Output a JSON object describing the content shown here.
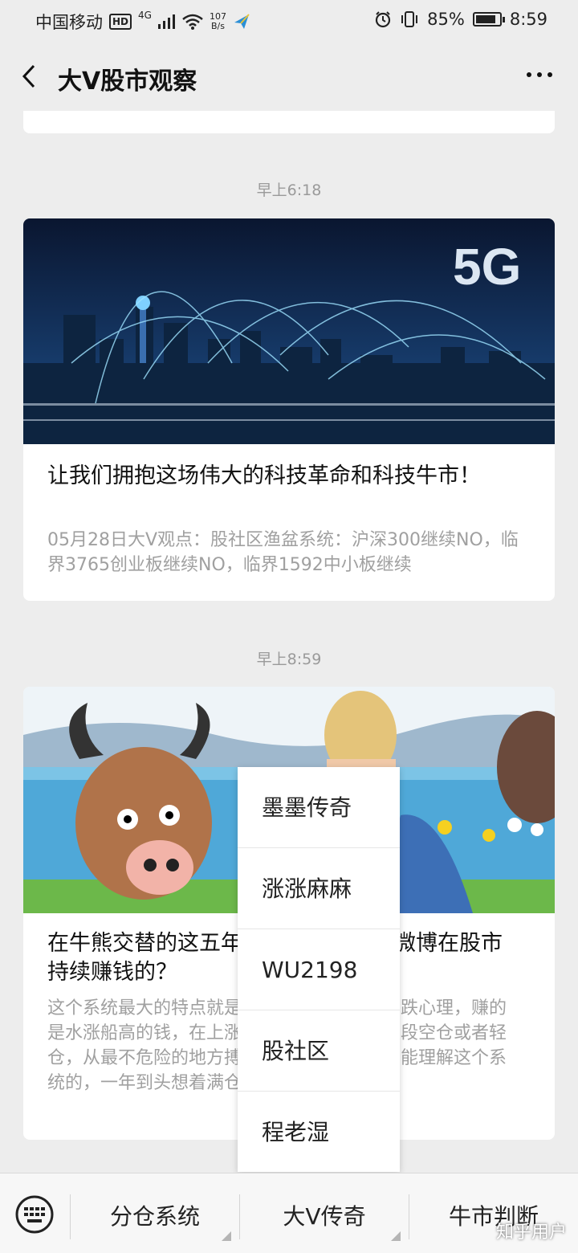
{
  "status_bar": {
    "carrier": "中国移动",
    "hd": "HD",
    "signal": "4G",
    "net_speed_value": "107",
    "net_speed_unit": "B/s",
    "battery": "85%",
    "battery_level": 0.85,
    "time": "8:59"
  },
  "header": {
    "title": "大V股市观察"
  },
  "messages": [
    {
      "time": "早上6:18",
      "image_text": "5G",
      "title": "让我们拥抱这场伟大的科技革命和科技牛市！",
      "desc": "05月28日大V观点：股社区渔盆系统：沪深300继续NO，临界3765创业板继续NO，临界1592中小板继续"
    },
    {
      "time": "早上8:59",
      "title": "在牛熊交替的这五年，他是如何靠刷微博在股市持续赚钱的？",
      "desc": "这个系统最大的特点就是利用散户们的追涨杀跌心理，赚的是水涨船高的钱，在上涨波段重仓，在下跌波段空仓或者轻仓，从最不危险的地方搏杀回来的钱散户是不能理解这个系统的，一年到头想着满仓赚不"
    }
  ],
  "popup_menu": {
    "items": [
      "墨墨传奇",
      "涨涨麻麻",
      "WU2198",
      "股社区",
      "程老湿"
    ]
  },
  "bottom_menu": {
    "items": [
      "分仓系统",
      "大V传奇",
      "牛市判断"
    ]
  },
  "watermark": "知乎用户",
  "colors": {
    "background": "#ededed",
    "card": "#ffffff",
    "muted_text": "#a0a0a0"
  }
}
